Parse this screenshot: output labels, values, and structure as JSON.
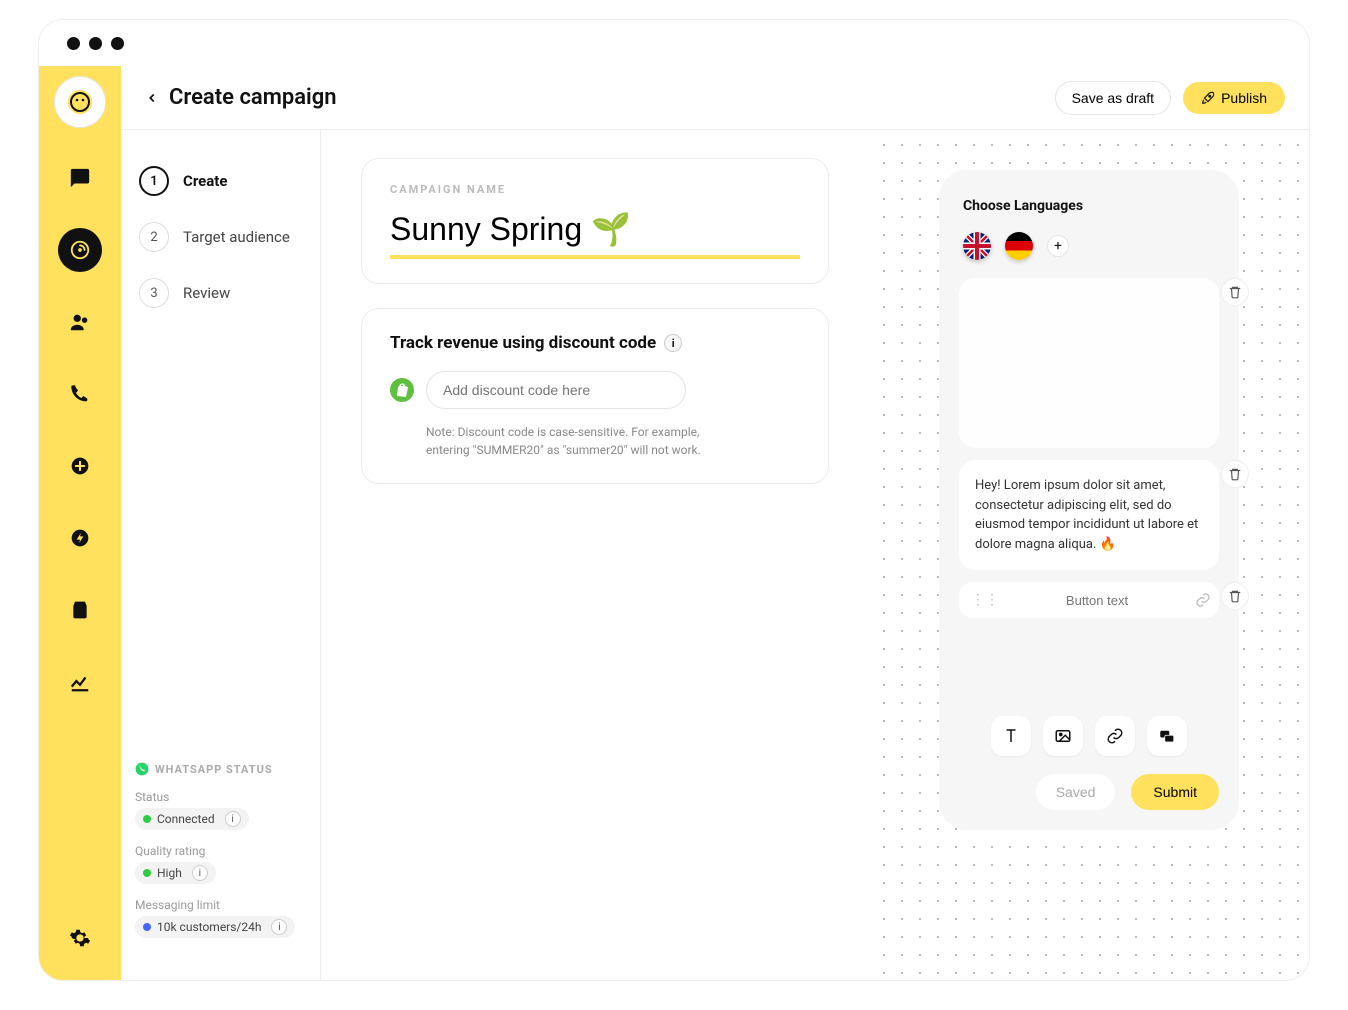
{
  "header": {
    "title": "Create campaign",
    "save_draft": "Save as draft",
    "publish": "Publish"
  },
  "steps": [
    {
      "num": "1",
      "label": "Create",
      "active": true
    },
    {
      "num": "2",
      "label": "Target audience",
      "active": false
    },
    {
      "num": "3",
      "label": "Review",
      "active": false
    }
  ],
  "whatsapp": {
    "section_title": "WHATSAPP STATUS",
    "status_label": "Status",
    "status_value": "Connected",
    "quality_label": "Quality rating",
    "quality_value": "High",
    "limit_label": "Messaging limit",
    "limit_value": "10k customers/24h"
  },
  "campaign": {
    "name_label": "CAMPAIGN NAME",
    "name_value": "Sunny Spring 🌱"
  },
  "discount": {
    "title": "Track revenue using discount code",
    "placeholder": "Add discount code here",
    "note": "Note: Discount code is case-sensitive. For example, entering \"SUMMER20\" as \"summer20\" will not work."
  },
  "preview": {
    "languages_title": "Choose Languages",
    "add_lang": "+",
    "message": "Hey! Lorem ipsum dolor sit amet, consectetur adipiscing elit, sed do eiusmod tempor incididunt ut labore et dolore magna aliqua. 🔥",
    "button_placeholder": "Button text",
    "saved": "Saved",
    "submit": "Submit"
  }
}
